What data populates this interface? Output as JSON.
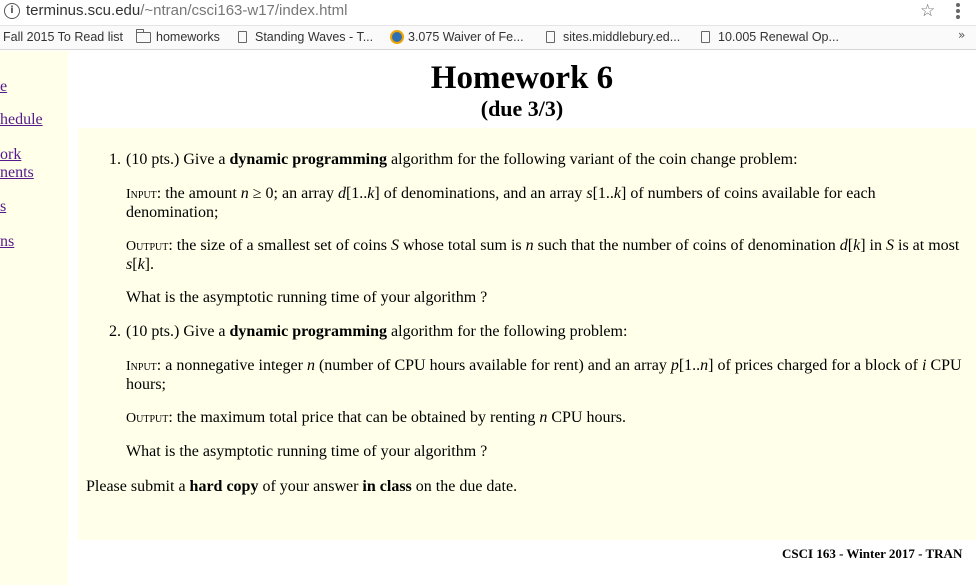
{
  "browser": {
    "url_host": "terminus.scu.edu",
    "url_path": "/~ntran/csci163-w17/index.html",
    "bookmarks": [
      {
        "label": "Fall 2015 To Read list",
        "icon": "none"
      },
      {
        "label": "homeworks",
        "icon": "folder-icon"
      },
      {
        "label": "Standing Waves - T...",
        "icon": "page-icon"
      },
      {
        "label": "3.075 Waiver of Fe...",
        "icon": "globe-icon"
      },
      {
        "label": "sites.middlebury.ed...",
        "icon": "page-icon"
      },
      {
        "label": "10.005 Renewal Op...",
        "icon": "page-icon"
      }
    ],
    "overflow": "»"
  },
  "sidebar": {
    "links": [
      "e",
      "hedule",
      "ork",
      "nents",
      "s",
      "ns"
    ]
  },
  "page": {
    "title": "Homework 6",
    "due": "(due 3/3)"
  },
  "problems": {
    "p1": {
      "number": "1.",
      "pts": "(10 pts.) Give a ",
      "bold": "dynamic programming",
      "rest": " algorithm for the following variant of the coin change problem:",
      "input_label": "Input",
      "input_a": ": the amount ",
      "input_b": " ≥ 0; an array ",
      "input_c": "[1..",
      "input_d": "] of denominations, and an array ",
      "input_e": "[1..",
      "input_f": "] of numbers of coins available for each",
      "input_line2": "denomination;",
      "output_label": "Output",
      "output_a": ": the size of a smallest set of coins ",
      "output_b": " whose total sum is ",
      "output_c": " such that the number of coins of denomination ",
      "output_d": "[",
      "output_e": "] in ",
      "output_f": " is at most",
      "output_line2_a": "[",
      "output_line2_b": "].",
      "question": "What is the asymptotic running time of your algorithm ?"
    },
    "p2": {
      "number": "2.",
      "pts": "(10 pts.) Give a ",
      "bold": "dynamic programming",
      "rest": " algorithm for the following problem:",
      "input_label": "Input",
      "input_a": ": a nonnegative integer ",
      "input_b": " (number of CPU hours available for rent) and an array ",
      "input_c": "[1..",
      "input_d": "] of prices charged for a block of ",
      "input_e": " CPU",
      "input_line2": "hours;",
      "output_label": "Output",
      "output_a": ": the maximum total price that can be obtained by renting ",
      "output_b": " CPU hours.",
      "question": "What is the asymptotic running time of your algorithm ?"
    }
  },
  "vars": {
    "n": "n",
    "d": "d",
    "s": "s",
    "k": "k",
    "S": "S",
    "p": "p",
    "i": "i"
  },
  "submit": {
    "a": "Please submit a ",
    "b": "hard copy",
    "c": " of your answer ",
    "d": "in class",
    "e": " on the due date."
  },
  "footer": "CSCI 163 - Winter 2017 - TRAN"
}
